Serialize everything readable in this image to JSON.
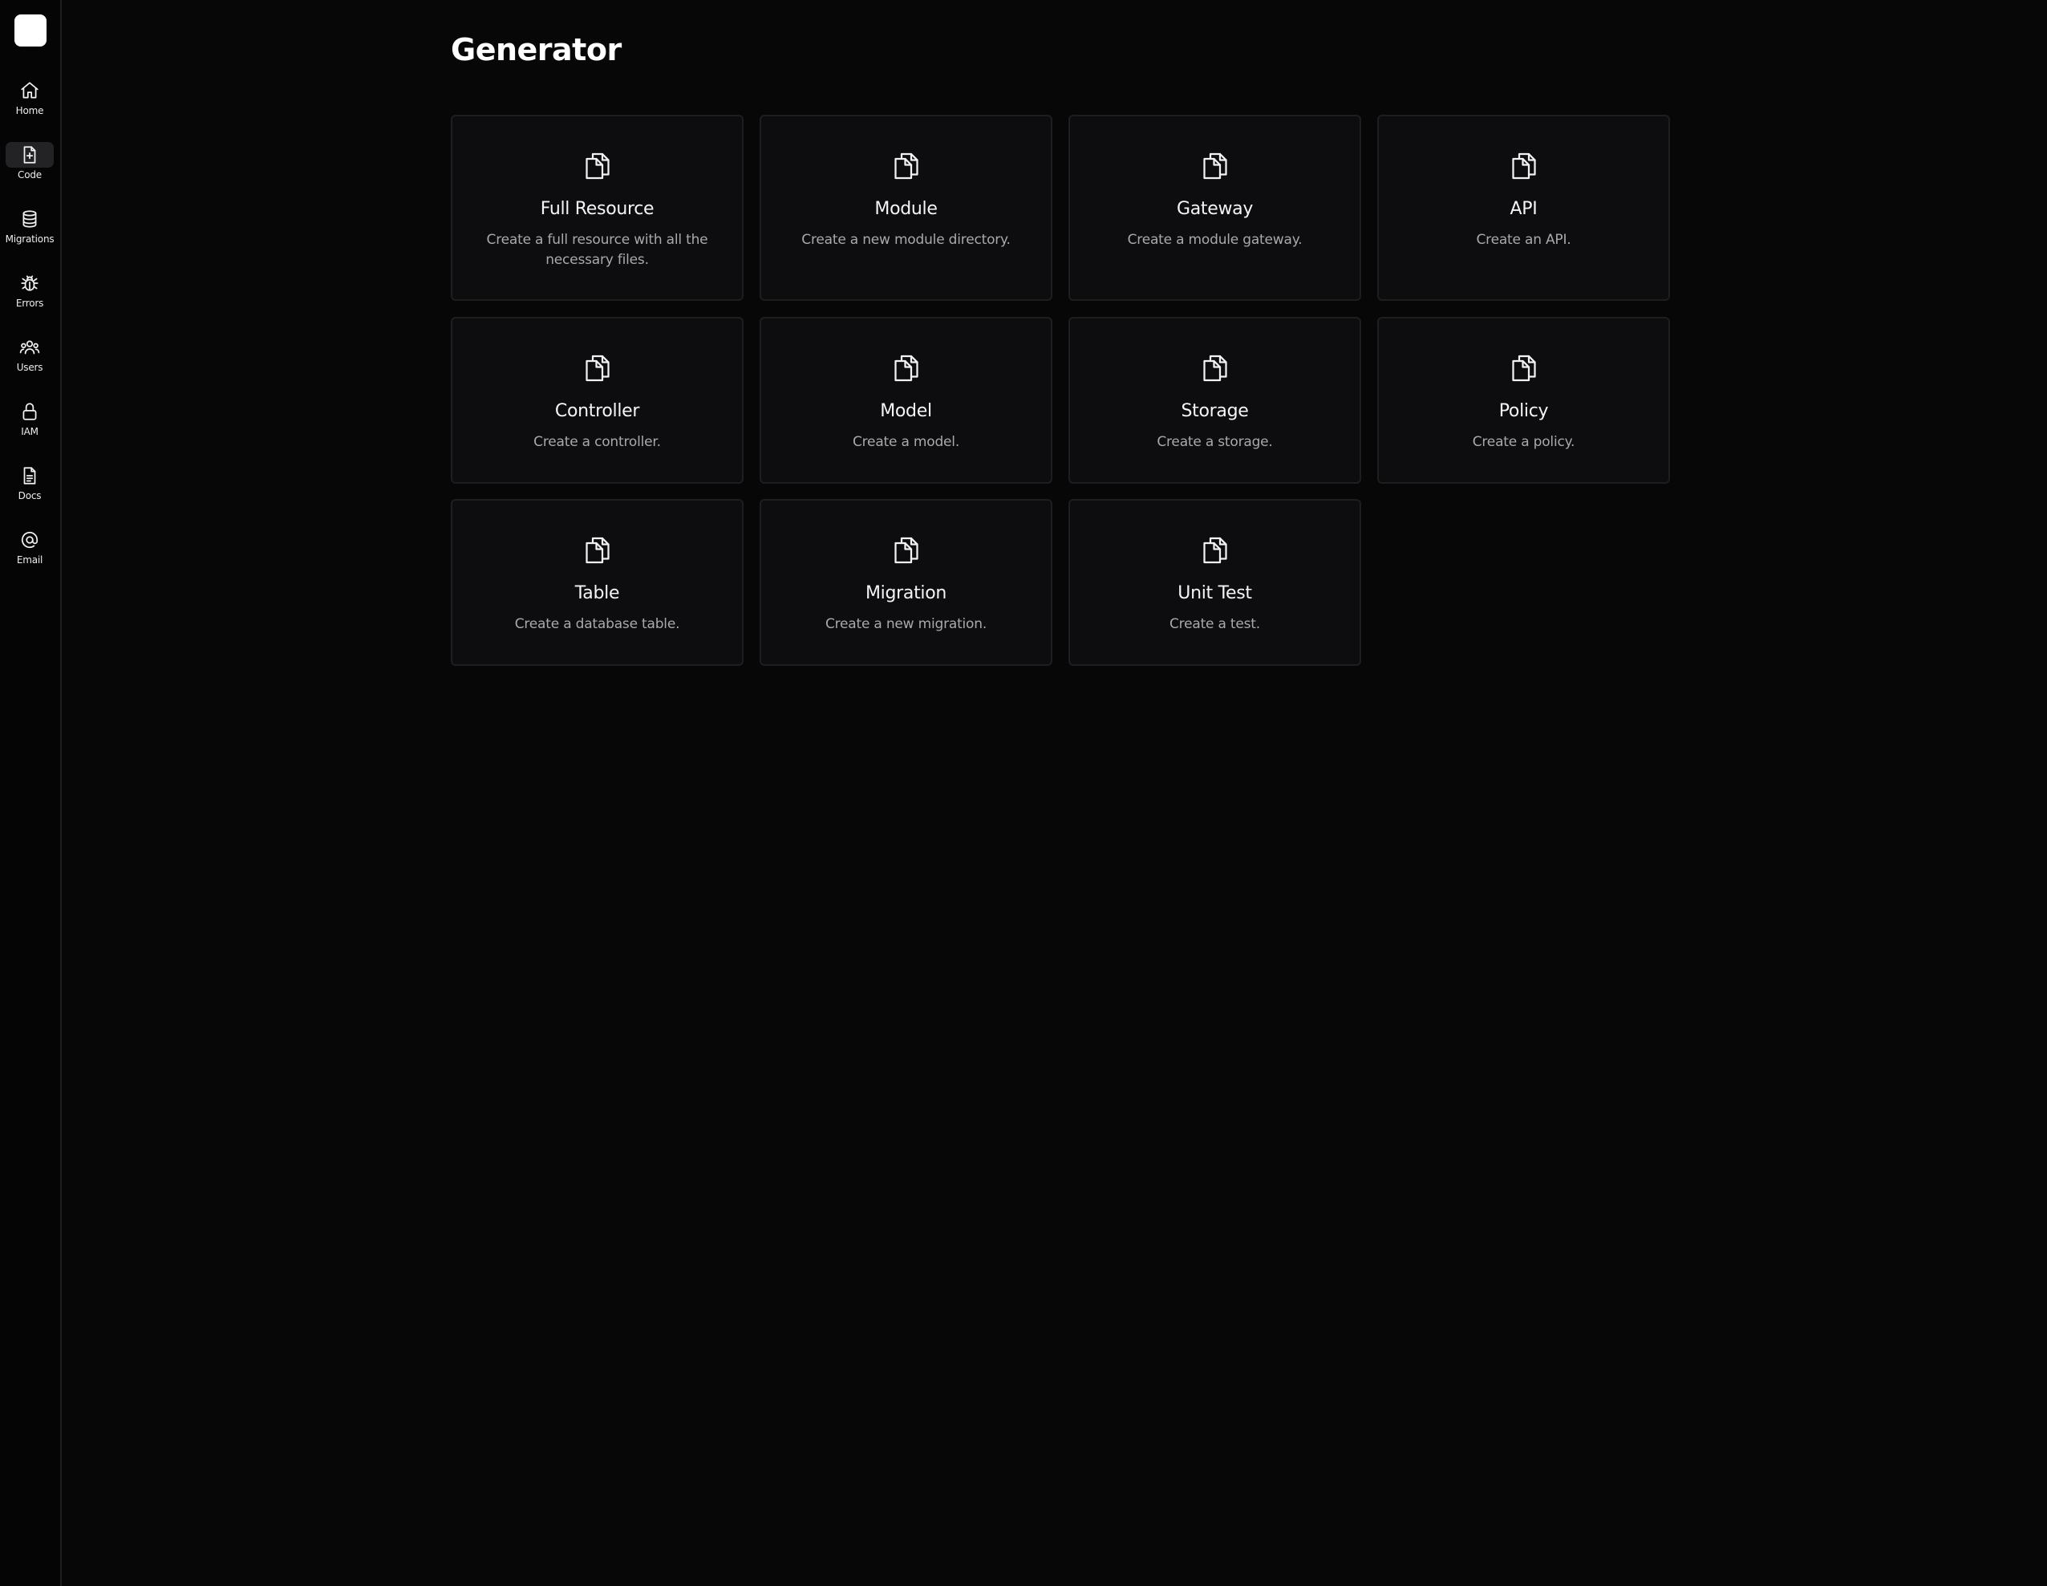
{
  "app": {
    "page_title": "Generator"
  },
  "colors": {
    "background": "#070707",
    "card_background": "#0d0d0f",
    "card_border": "#1e1e21",
    "active_nav": "#232326",
    "text_primary": "#f5f5f5",
    "text_secondary": "#a9a9ad"
  },
  "sidebar": {
    "items": [
      {
        "label": "Home",
        "icon": "home-icon",
        "active": false
      },
      {
        "label": "Code",
        "icon": "file-plus-icon",
        "active": true
      },
      {
        "label": "Migrations",
        "icon": "database-icon",
        "active": false
      },
      {
        "label": "Errors",
        "icon": "bug-icon",
        "active": false
      },
      {
        "label": "Users",
        "icon": "users-icon",
        "active": false
      },
      {
        "label": "IAM",
        "icon": "lock-icon",
        "active": false
      },
      {
        "label": "Docs",
        "icon": "document-icon",
        "active": false
      },
      {
        "label": "Email",
        "icon": "at-sign-icon",
        "active": false
      }
    ]
  },
  "cards": [
    {
      "title": "Full Resource",
      "description": "Create a full resource with all the necessary files.",
      "icon": "files-icon"
    },
    {
      "title": "Module",
      "description": "Create a new module directory.",
      "icon": "files-icon"
    },
    {
      "title": "Gateway",
      "description": "Create a module gateway.",
      "icon": "files-icon"
    },
    {
      "title": "API",
      "description": "Create an API.",
      "icon": "files-icon"
    },
    {
      "title": "Controller",
      "description": "Create a controller.",
      "icon": "files-icon"
    },
    {
      "title": "Model",
      "description": "Create a model.",
      "icon": "files-icon"
    },
    {
      "title": "Storage",
      "description": "Create a storage.",
      "icon": "files-icon"
    },
    {
      "title": "Policy",
      "description": "Create a policy.",
      "icon": "files-icon"
    },
    {
      "title": "Table",
      "description": "Create a database table.",
      "icon": "files-icon"
    },
    {
      "title": "Migration",
      "description": "Create a new migration.",
      "icon": "files-icon"
    },
    {
      "title": "Unit Test",
      "description": "Create a test.",
      "icon": "files-icon"
    }
  ]
}
